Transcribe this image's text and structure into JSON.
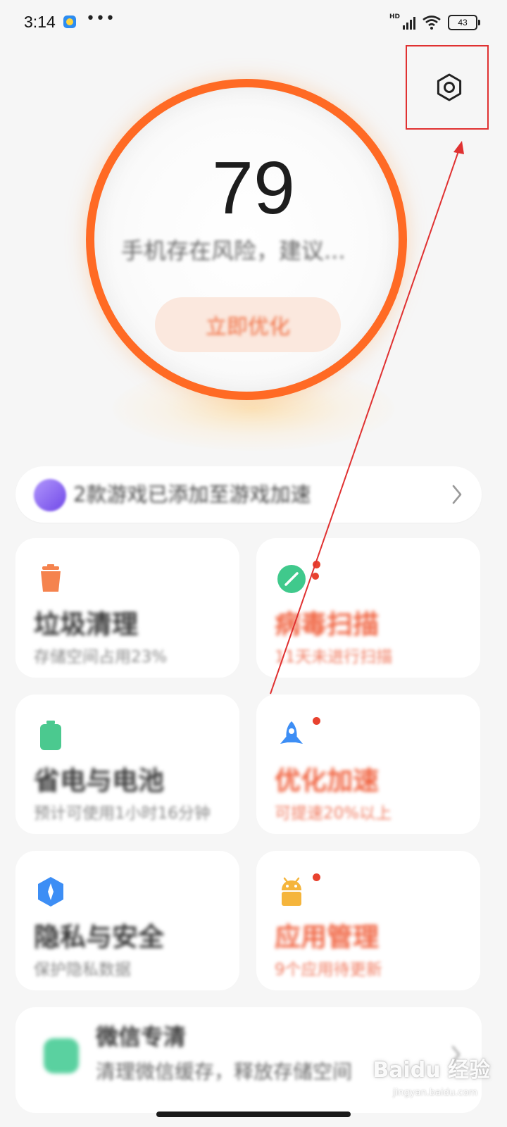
{
  "status_bar": {
    "time": "3:14",
    "more": "•••",
    "network_label": "HD",
    "battery": "43"
  },
  "score": {
    "value": "79",
    "message": "手机存在风险，建议...",
    "button_label": "立即优化",
    "ring_color": "#ff6a24"
  },
  "banner": {
    "text": "2款游戏已添加至游戏加速"
  },
  "cards": [
    {
      "title": "垃圾清理",
      "subtitle": "存储空间占用23%",
      "icon": "trash-icon",
      "color": "#f5834e",
      "alert": false,
      "dot": false
    },
    {
      "title": "病毒扫描",
      "subtitle": "11天未进行扫描",
      "icon": "scan-icon",
      "color": "#40c98c",
      "alert": true,
      "dot": true
    },
    {
      "title": "省电与电池",
      "subtitle": "预计可使用1小时16分钟",
      "icon": "battery-icon",
      "color": "#4bc98f",
      "alert": false,
      "dot": false
    },
    {
      "title": "优化加速",
      "subtitle": "可提速20%以上",
      "icon": "rocket-icon",
      "color": "#3d8ef5",
      "alert": true,
      "dot": true
    },
    {
      "title": "隐私与安全",
      "subtitle": "保护隐私数据",
      "icon": "shield-icon",
      "color": "#3d8ef5",
      "alert": false,
      "dot": false
    },
    {
      "title": "应用管理",
      "subtitle": "9个应用待更新",
      "icon": "android-icon",
      "color": "#f5b53c",
      "alert": true,
      "dot": true
    }
  ],
  "bottom_card": {
    "title": "微信专清",
    "subtitle": "清理微信缓存，释放存储空间"
  },
  "watermark": {
    "text": "Baidu 经验",
    "url": "jingyan.baidu.com"
  },
  "annotation_color": "#e03131"
}
